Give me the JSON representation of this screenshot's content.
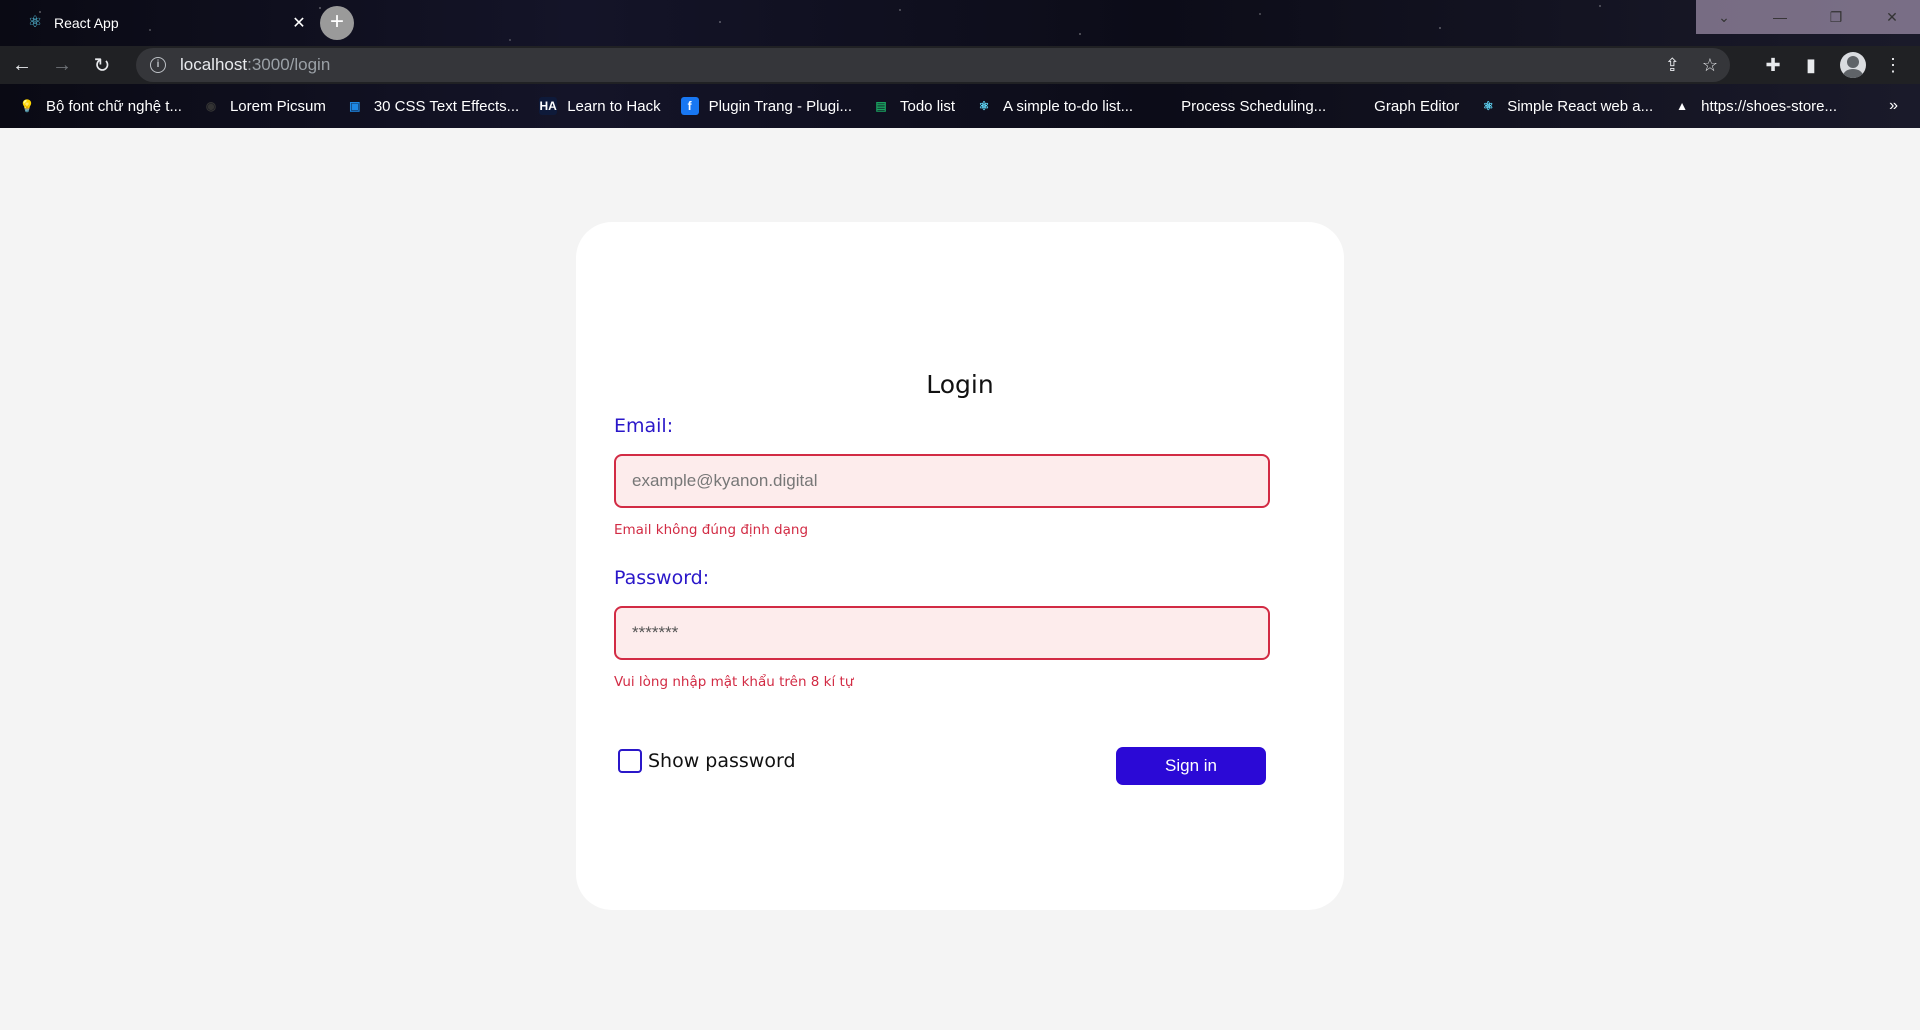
{
  "browser": {
    "tab_title": "React App",
    "url_host": "localhost",
    "url_path": ":3000/login",
    "bookmarks": [
      {
        "label": "Bộ font chữ nghệ t...",
        "icon": "lightbulb-icon",
        "color": "#f5b400",
        "glyph": "💡"
      },
      {
        "label": "Lorem Picsum",
        "icon": "camera-icon",
        "color": "#333333",
        "glyph": "◉"
      },
      {
        "label": "30 CSS Text Effects...",
        "icon": "codepen-icon",
        "color": "#1e88e5",
        "glyph": "▣"
      },
      {
        "label": "Learn to Hack",
        "icon": "hack-icon",
        "color": "#0e1a3a",
        "glyph": "HA"
      },
      {
        "label": "Plugin Trang - Plugi...",
        "icon": "facebook-icon",
        "color": "#1877f2",
        "glyph": "f"
      },
      {
        "label": "Todo list",
        "icon": "sheet-icon",
        "color": "#1aa260",
        "glyph": "▤"
      },
      {
        "label": "A simple to-do list...",
        "icon": "react-icon",
        "color": "#61dafb",
        "glyph": "⚛"
      },
      {
        "label": "Process Scheduling...",
        "icon": "blank-page-icon",
        "color": "transparent",
        "glyph": ""
      },
      {
        "label": "Graph Editor",
        "icon": "blank-page-icon",
        "color": "transparent",
        "glyph": ""
      },
      {
        "label": "Simple React web a...",
        "icon": "react-icon",
        "color": "#61dafb",
        "glyph": "⚛"
      },
      {
        "label": "https://shoes-store...",
        "icon": "triangle-icon",
        "color": "transparent",
        "glyph": "▲"
      }
    ],
    "bookmarks_more": "»"
  },
  "login": {
    "title": "Login",
    "email_label": "Email:",
    "email_placeholder": "example@kyanon.digital",
    "email_value": "",
    "email_error": "Email không đúng định dạng",
    "password_label": "Password:",
    "password_value": "*******",
    "password_error": "Vui lòng nhập mật khẩu trên 8 kí tự",
    "show_password_label": "Show password",
    "show_password_checked": false,
    "signin_label": "Sign in"
  },
  "colors": {
    "accent": "#2b09d6",
    "label": "#2a17c9",
    "error": "#d22b44",
    "error_bg": "#fdecec"
  }
}
